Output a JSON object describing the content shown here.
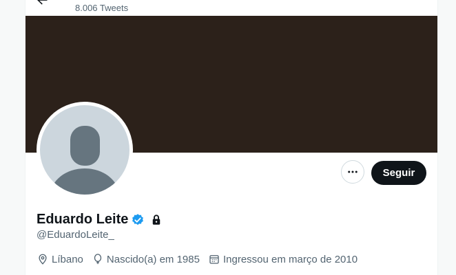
{
  "header": {
    "tweet_count": "8.006 Tweets"
  },
  "profile": {
    "name": "Eduardo Leite",
    "handle": "@EduardoLeite_",
    "location": "Líbano",
    "birth": "Nascido(a) em 1985",
    "joined": "Ingressou em março de 2010"
  },
  "actions": {
    "follow_label": "Seguir"
  },
  "colors": {
    "banner": "#2c211a",
    "accent": "#1d9bf0",
    "follow_bg": "#0f1419",
    "secondary_text": "#536471"
  },
  "icons": [
    "back-arrow-icon",
    "more-icon",
    "verified-icon",
    "lock-icon",
    "location-icon",
    "balloon-icon",
    "calendar-icon"
  ]
}
